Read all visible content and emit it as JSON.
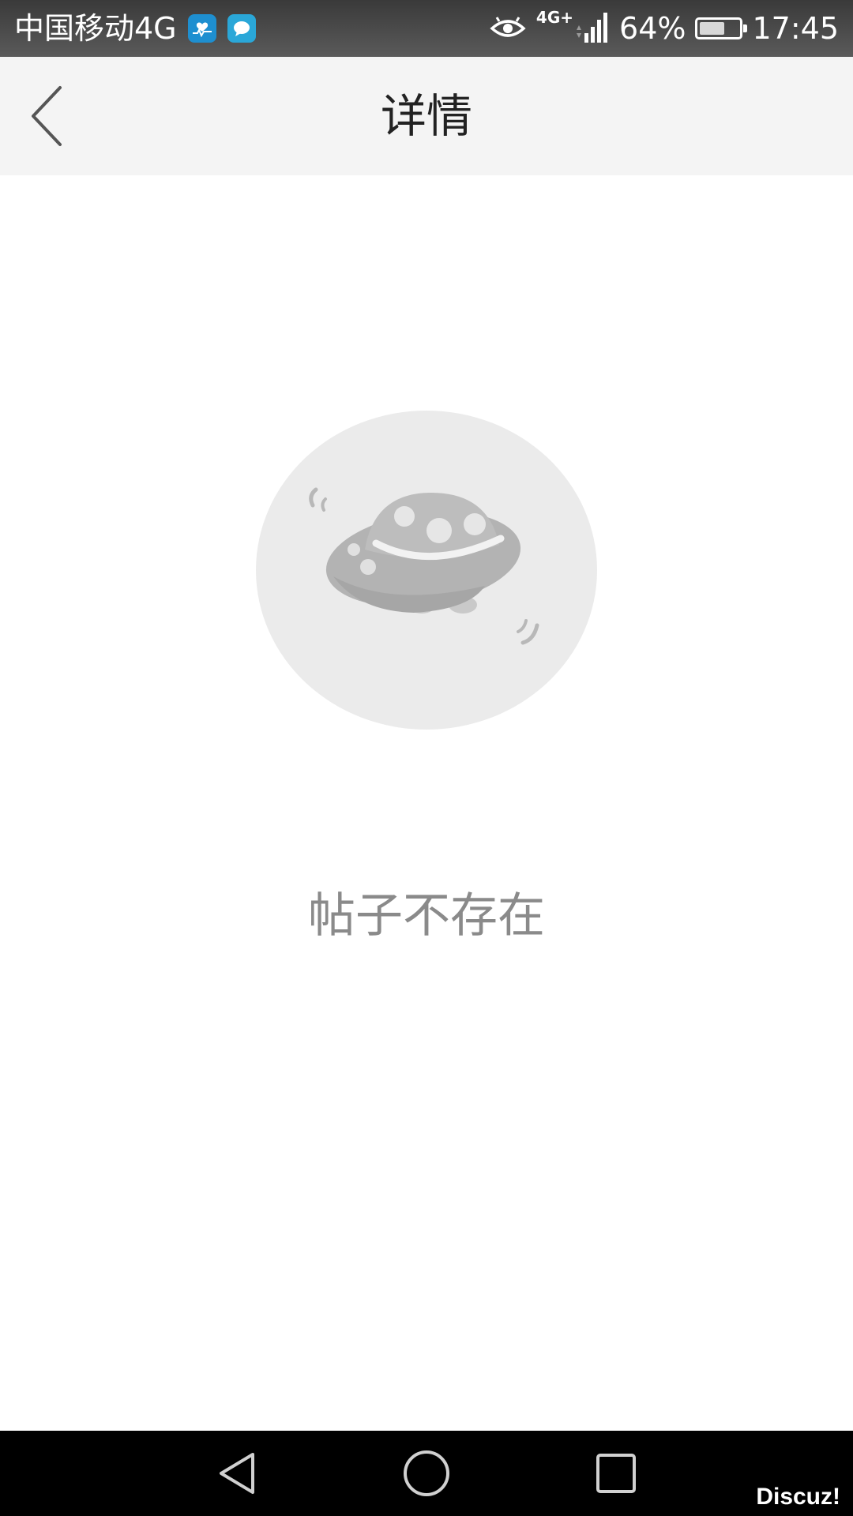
{
  "status_bar": {
    "carrier": "中国移动4G",
    "network_label": "4G+",
    "battery_percent": "64%",
    "battery_level": 0.64,
    "time": "17:45",
    "icons": [
      "health-app-icon",
      "chat-app-icon",
      "eye-care-icon",
      "signal-icon",
      "battery-icon"
    ]
  },
  "header": {
    "back_icon": "chevron-left-icon",
    "title": "详情"
  },
  "empty_state": {
    "illustration": "ufo-illustration",
    "message": "帖子不存在"
  },
  "nav_bar": {
    "buttons": [
      "back-triangle-icon",
      "home-circle-icon",
      "recents-square-icon"
    ],
    "watermark": "Discuz!"
  },
  "colors": {
    "status_bar": "#4a4a4a",
    "header_bg": "#f4f4f4",
    "title_text": "#222222",
    "message_text": "#8a8a8a",
    "illustration_bg": "#ebebeb",
    "ufo_body": "#b3b3b3",
    "nav_bar": "#000000"
  }
}
